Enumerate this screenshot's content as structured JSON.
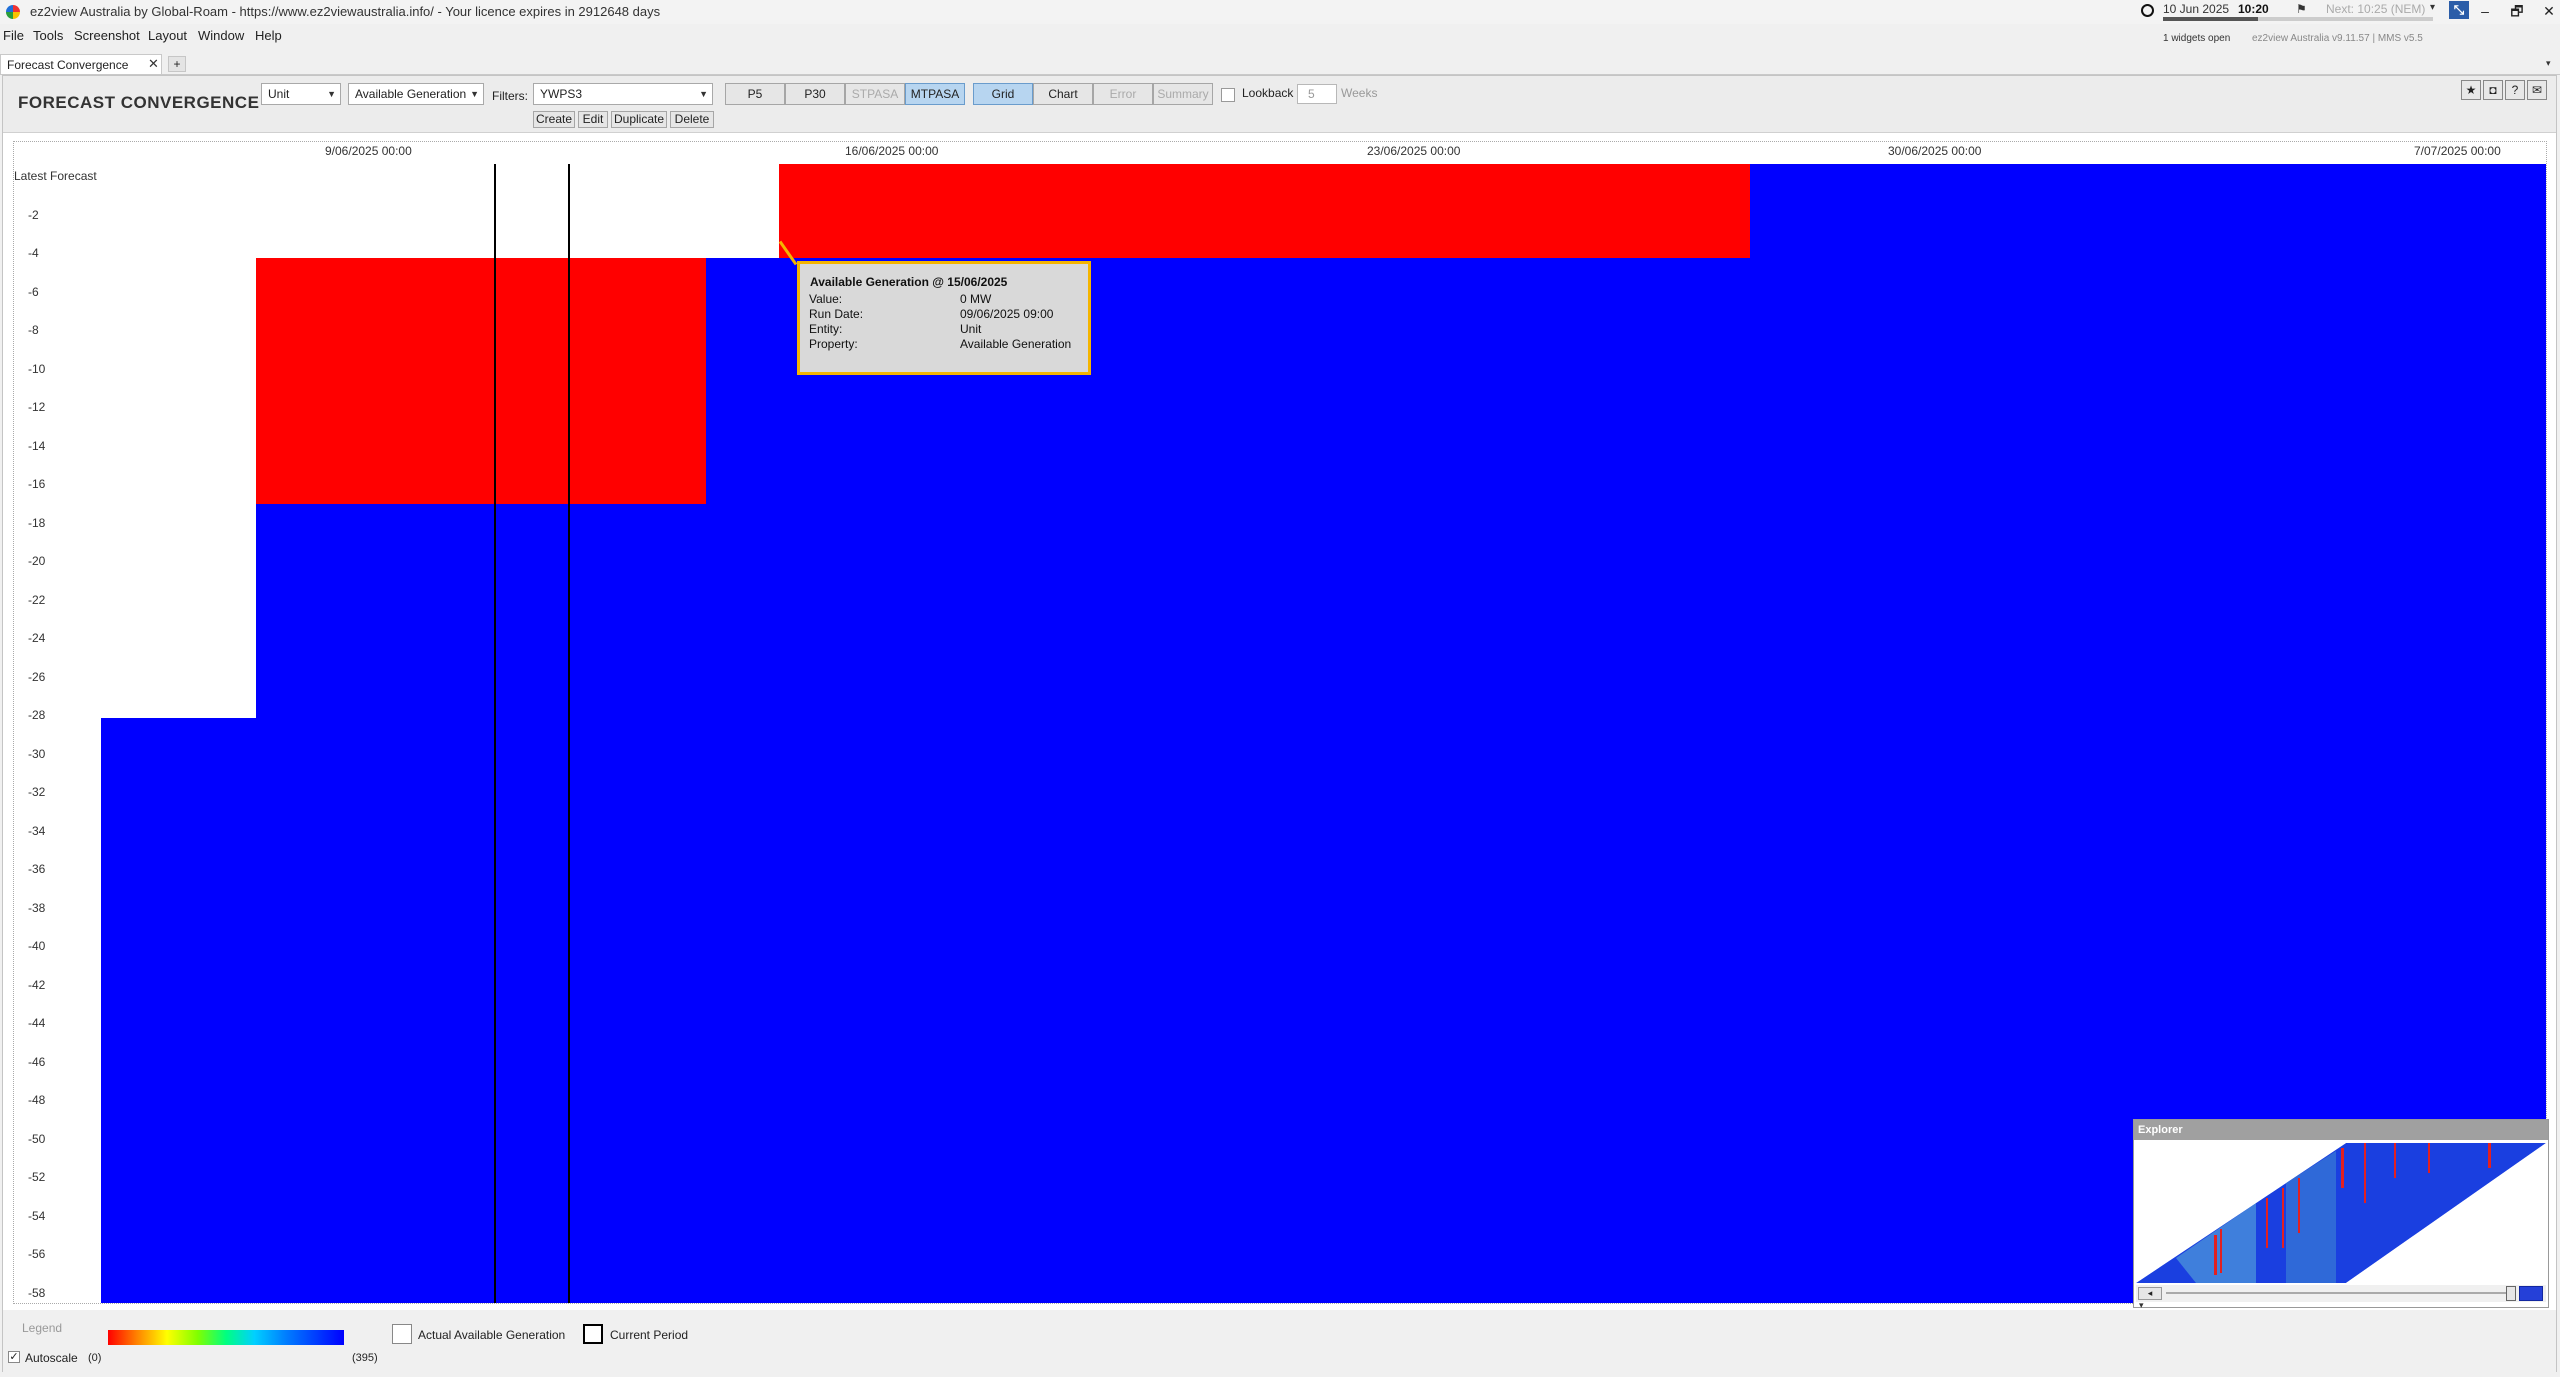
{
  "titlebar": {
    "title": "ez2view Australia by Global-Roam - https://www.ez2viewaustralia.info/ - Your licence expires in 2912648 days",
    "date": "10 Jun 2025",
    "time": "10:20",
    "next": "Next: 10:25 (NEM)",
    "time_progress": 0.35,
    "minimize": "–",
    "restore": "🗗",
    "close": "✕",
    "pin_label": "⤡"
  },
  "menu": {
    "items": [
      "File",
      "Tools",
      "Screenshot",
      "Layout",
      "Window",
      "Help"
    ],
    "widgets_open": "1 widgets open",
    "version": "ez2view Australia v9.11.57 | MMS v5.5"
  },
  "tabs": {
    "active": "Forecast Convergence",
    "close": "✕",
    "add": "+"
  },
  "toolbar": {
    "title": "FORECAST CONVERGENCE",
    "entity_select": "Unit",
    "property_select": "Available Generation",
    "filters_label": "Filters:",
    "filter_value": "YWPS3",
    "sources": [
      {
        "label": "P5",
        "state": "normal"
      },
      {
        "label": "P30",
        "state": "normal"
      },
      {
        "label": "STPASA",
        "state": "disabled"
      },
      {
        "label": "MTPASA",
        "state": "selected"
      }
    ],
    "views": [
      {
        "label": "Grid",
        "state": "selected"
      },
      {
        "label": "Chart",
        "state": "normal"
      },
      {
        "label": "Error",
        "state": "disabled"
      },
      {
        "label": "Summary",
        "state": "disabled"
      }
    ],
    "lookback_label": "Lookback",
    "lookback_weeks": "5",
    "weeks_label": "Weeks",
    "actions": [
      "Create",
      "Edit",
      "Duplicate",
      "Delete"
    ],
    "icons": [
      "star-icon",
      "camera-icon",
      "help-icon",
      "comment-icon"
    ]
  },
  "chart": {
    "x_ticks": [
      "9/06/2025 00:00",
      "16/06/2025 00:00",
      "23/06/2025 00:00",
      "30/06/2025 00:00",
      "7/07/2025 00:00"
    ],
    "y_labels": [
      "Latest Forecast",
      "-2",
      "-4",
      "-6",
      "-8",
      "-10",
      "-12",
      "-14",
      "-16",
      "-18",
      "-20",
      "-22",
      "-24",
      "-26",
      "-28",
      "-30",
      "-32",
      "-34",
      "-36",
      "-38",
      "-40",
      "-42",
      "-44",
      "-46",
      "-48",
      "-50",
      "-52",
      "-54",
      "-56",
      "-58"
    ],
    "colors": {
      "high": "#0000ff",
      "low": "#ff0000",
      "empty": "#ffffff"
    }
  },
  "tooltip": {
    "title": "Available Generation @ 15/06/2025",
    "rows": [
      {
        "key": "Value:",
        "value": "0 MW"
      },
      {
        "key": "Run Date:",
        "value": "09/06/2025 09:00"
      },
      {
        "key": "Entity:",
        "value": "Unit"
      },
      {
        "key": "Property:",
        "value": "Available Generation"
      }
    ]
  },
  "explorer": {
    "title": "Explorer"
  },
  "legend": {
    "label": "Legend",
    "autoscale_label": "Autoscale",
    "autoscale_checked": true,
    "min_label": "(0)",
    "max_label": "(395)",
    "actual_label": "Actual Available Generation",
    "current_label": "Current Period"
  }
}
